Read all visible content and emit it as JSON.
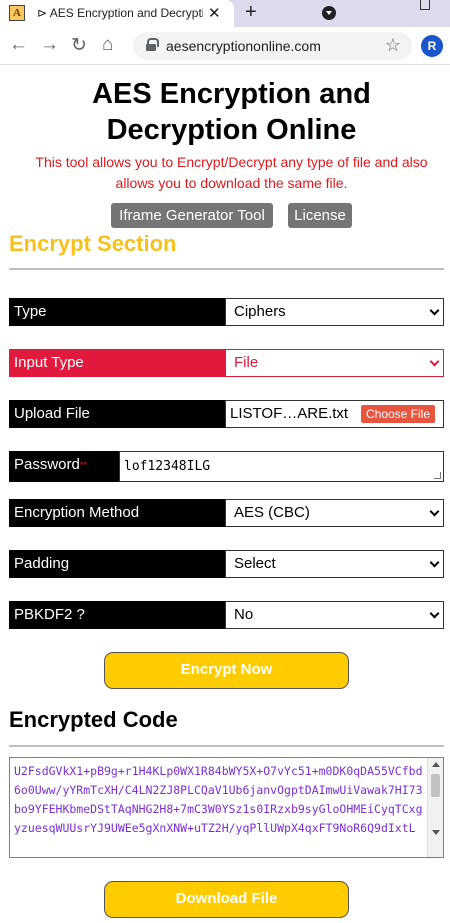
{
  "browser": {
    "tab_title": "⊳ AES Encryption and Decryptic",
    "favicon_letter": "A",
    "url": "aesencryptiononline.com",
    "profile_initial": "R"
  },
  "page": {
    "title_line1": "AES Encryption and",
    "title_line2": "Decryption Online",
    "description_line1": "This tool allows you to Encrypt/Decrypt any type of file and also",
    "description_line2": "allows you to download the same file.",
    "iframe_button": "Iframe Generator Tool",
    "license_button": "License"
  },
  "encrypt_section": {
    "title": "Encrypt Section",
    "type": {
      "label": "Type",
      "value": "Ciphers"
    },
    "input_type": {
      "label": "Input Type",
      "value": "File"
    },
    "upload_file": {
      "label": "Upload File",
      "file_name": "LISTOF…ARE.txt",
      "button": "Choose File"
    },
    "password": {
      "label": "Password",
      "required_mark": "**",
      "value": "lof12348ILG"
    },
    "encryption_method": {
      "label": "Encryption Method",
      "value": "AES (CBC)"
    },
    "padding": {
      "label": "Padding",
      "value": "Select"
    },
    "pbkdf2": {
      "label": "PBKDF2 ?",
      "value": "No"
    },
    "encrypt_button": "Encrypt Now"
  },
  "encrypted_code": {
    "title": "Encrypted Code",
    "text": "U2FsdGVkX1+pB9g+r1H4KLp0WX1R84bWY5X+O7vYc51+m0DK0qDA55VCfbd6o0Uww/yYRmTcXH/C4LN2ZJ8PLCQaV1Ub6janvOgptDAImwUiVawak7HI73bo9YFEHKbmeDStTAqNHG2H8+7mC3W0YSz1s0IRzxb9syGloOHMEiCyqTCxgyzuesqWUUsrYJ9UWEe5gXnXNW+uTZ2H/yqPllUWpX4qxFT9NoR6Q9dIxtL",
    "download_button": "Download File"
  },
  "colors": {
    "accent_yellow": "#ffcc00",
    "section_title": "#f5c21d",
    "error_red": "#e0193d",
    "code_purple": "#7b2fd6"
  }
}
